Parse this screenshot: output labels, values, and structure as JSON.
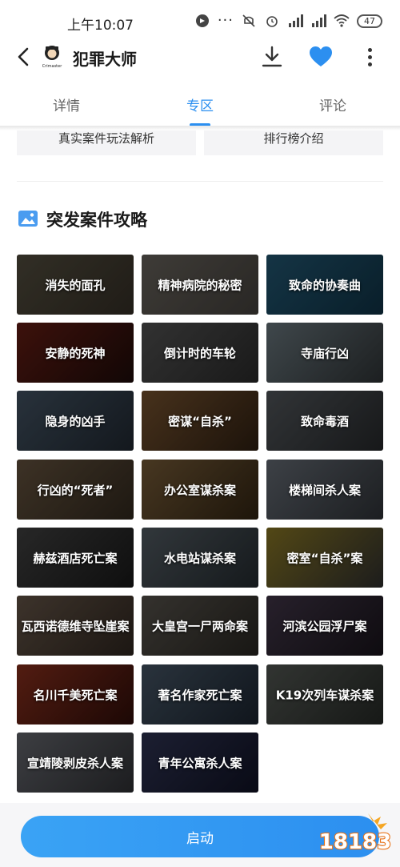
{
  "status_bar": {
    "time": "上午10:07",
    "more_dots": "···",
    "battery": "47"
  },
  "header": {
    "title": "犯罪大师",
    "logo_text": "Crimaster"
  },
  "tabs": [
    {
      "label": "详情",
      "active": false
    },
    {
      "label": "专区",
      "active": true
    },
    {
      "label": "评论",
      "active": false
    }
  ],
  "top_cards": [
    "真实案件玩法解析",
    "排行榜介绍"
  ],
  "section": {
    "title": "突发案件攻略"
  },
  "cases": [
    {
      "title": "消失的面孔",
      "colors": [
        "#4a4538",
        "#2f2a22"
      ]
    },
    {
      "title": "精神病院的秘密",
      "colors": [
        "#5c5852",
        "#3d3a36"
      ]
    },
    {
      "title": "致命的协奏曲",
      "colors": [
        "#1f4e66",
        "#0e2d3e"
      ]
    },
    {
      "title": "安静的死神",
      "colors": [
        "#5a1a12",
        "#1a0a08"
      ]
    },
    {
      "title": "倒计时的车轮",
      "colors": [
        "#4a4a4a",
        "#262626"
      ]
    },
    {
      "title": "寺庙行凶",
      "colors": [
        "#5e6a70",
        "#2a2e30"
      ]
    },
    {
      "title": "隐身的凶手",
      "colors": [
        "#3c4a58",
        "#1d242c"
      ]
    },
    {
      "title": "密谋“自杀”",
      "colors": [
        "#6a4a2a",
        "#2a1c10"
      ]
    },
    {
      "title": "致命毒酒",
      "colors": [
        "#4a4e52",
        "#222426"
      ]
    },
    {
      "title": "行凶的“死者”",
      "colors": [
        "#5a4a38",
        "#2c241a"
      ]
    },
    {
      "title": "办公室谋杀案",
      "colors": [
        "#6a5232",
        "#2c2010"
      ]
    },
    {
      "title": "楼梯间杀人案",
      "colors": [
        "#5a6068",
        "#2a2d31"
      ]
    },
    {
      "title": "赫兹酒店死亡案",
      "colors": [
        "#3a3a3a",
        "#161616"
      ]
    },
    {
      "title": "水电站谋杀案",
      "colors": [
        "#4a5258",
        "#20262a"
      ]
    },
    {
      "title": "密室“自杀”案",
      "colors": [
        "#7a6a20",
        "#2a2a2a"
      ]
    },
    {
      "title": "瓦西诺德维寺坠崖案",
      "colors": [
        "#5a4c40",
        "#2a221c"
      ]
    },
    {
      "title": "大皇宫一尸两命案",
      "colors": [
        "#4e4a44",
        "#24221e"
      ]
    },
    {
      "title": "河滨公园浮尸案",
      "colors": [
        "#3a3040",
        "#161218"
      ]
    },
    {
      "title": "名川千美死亡案",
      "colors": [
        "#7a2a1a",
        "#2a0c08"
      ]
    },
    {
      "title": "著名作家死亡案",
      "colors": [
        "#3e4c5a",
        "#18202a"
      ]
    },
    {
      "title": "K19次列车谋杀案",
      "colors": [
        "#4a4e4a",
        "#222522"
      ]
    },
    {
      "title": "宣靖陵剥皮杀人案",
      "colors": [
        "#5a5c62",
        "#2a2b2e"
      ]
    },
    {
      "title": "青年公寓杀人案",
      "colors": [
        "#2a2e4a",
        "#0e1020"
      ]
    }
  ],
  "bottom": {
    "launch_label": "启动",
    "watermark": "18183"
  }
}
